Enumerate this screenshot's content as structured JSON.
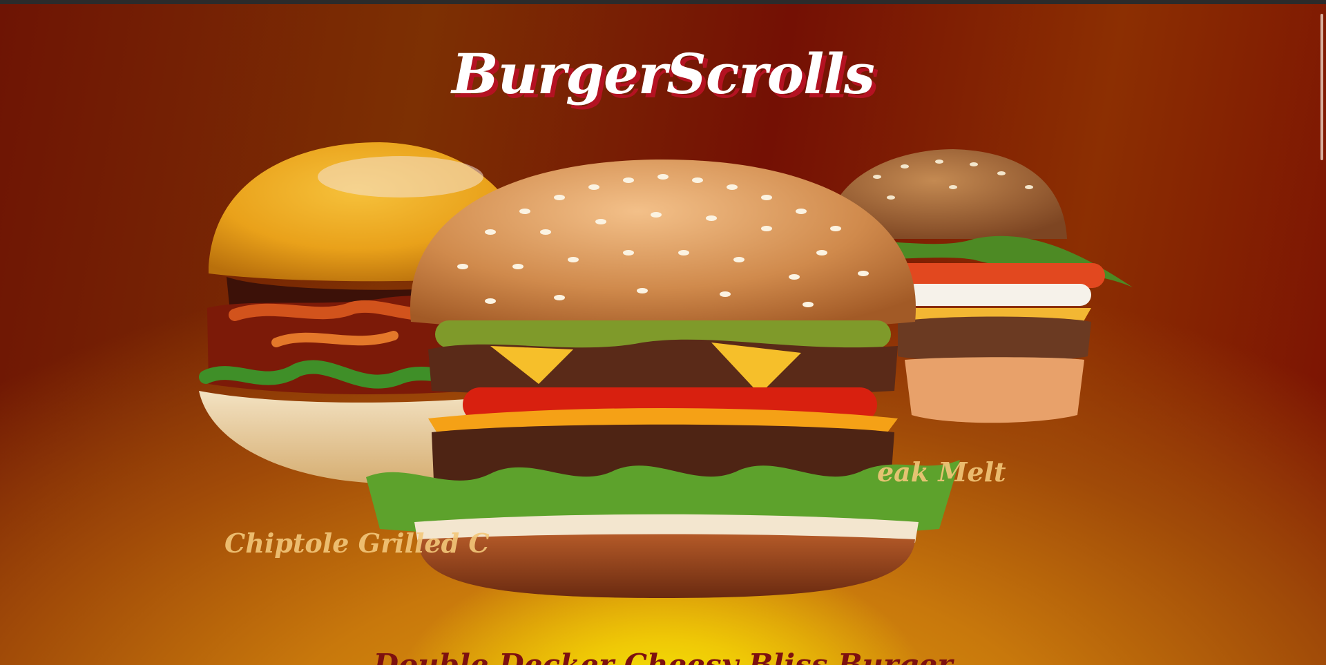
{
  "site": {
    "title": "BurgerScrolls"
  },
  "burgers": {
    "left": {
      "name": "Chiptole Grilled C"
    },
    "right": {
      "name": "eak Melt"
    },
    "center": {
      "name": "Double Decker Cheesy Bliss Burger"
    }
  },
  "colors": {
    "title_shadow": "#b41222",
    "background_dark": "#741004",
    "background_glow": "#f6ea06",
    "side_name": "#f3c77a",
    "center_name": "#7d1010"
  }
}
